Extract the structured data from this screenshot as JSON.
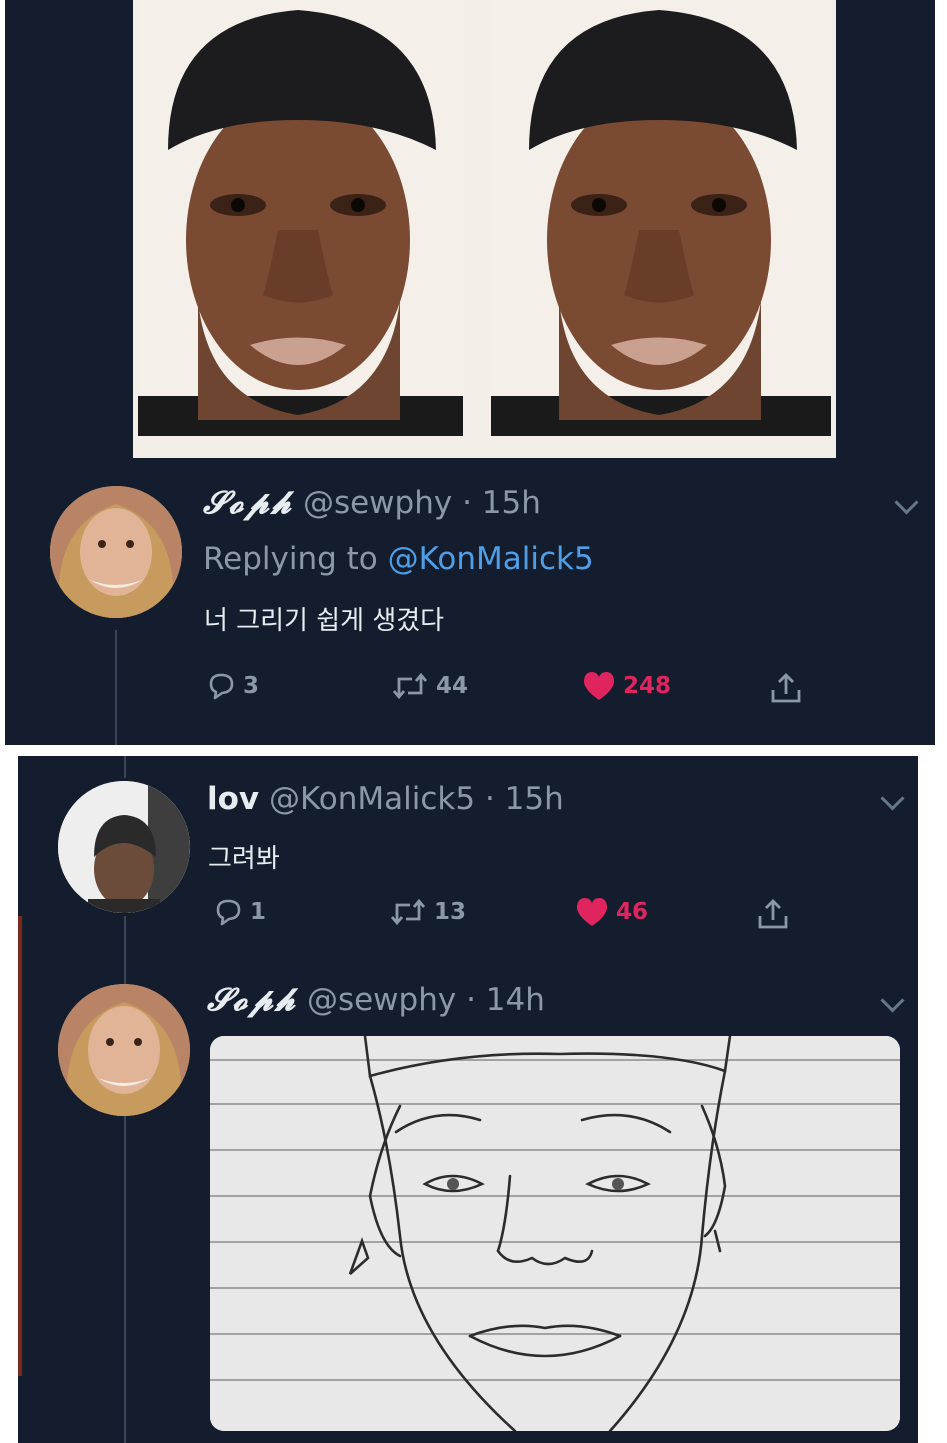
{
  "tweets": [
    {
      "display_name": "𝓢𝓸𝓹𝓱",
      "handle": "@sewphy",
      "time": "· 15h",
      "replying_prefix": "Replying to",
      "replying_to": "@KonMalick5",
      "text": "너 그리기 쉽게 생겼다",
      "replies": "3",
      "retweets": "44",
      "likes": "248"
    },
    {
      "display_name": "lov",
      "handle": "@KonMalick5",
      "time": "· 15h",
      "text": "그려봐",
      "replies": "1",
      "retweets": "13",
      "likes": "46"
    },
    {
      "display_name": "𝓢𝓸𝓹𝓱",
      "handle": "@sewphy",
      "time": "· 14h"
    }
  ],
  "icons": {
    "reply": "reply-icon",
    "retweet": "retweet-icon",
    "like": "heart-icon",
    "share": "share-icon",
    "more": "chevron-down-icon"
  },
  "colors": {
    "background": "#141d2d",
    "mention": "#4e9ee8",
    "like": "#e0245e",
    "muted": "#8b98a6"
  }
}
